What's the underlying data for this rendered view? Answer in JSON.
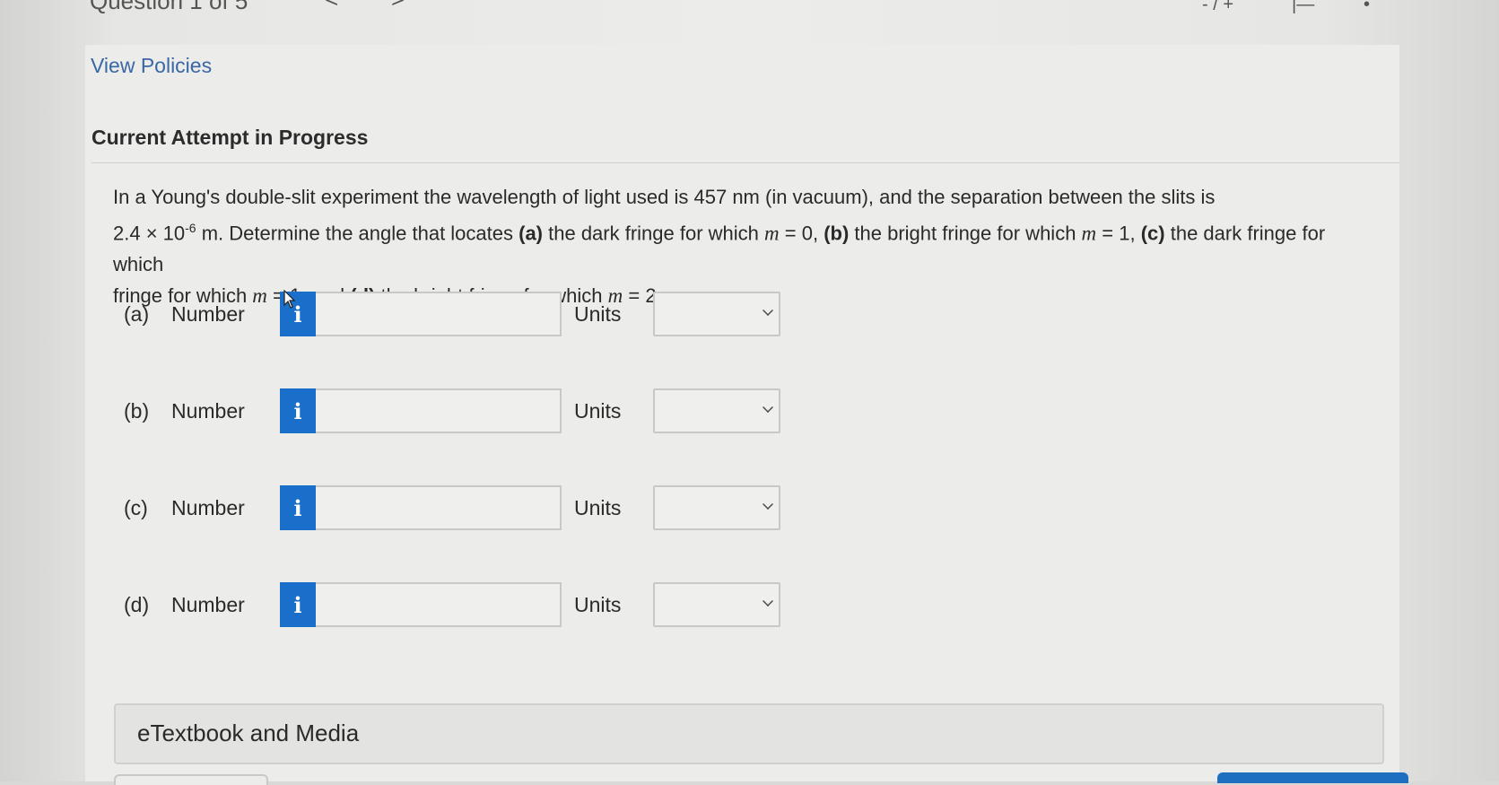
{
  "header": {
    "question_counter": "Question 1 of 5",
    "prev_arrow": "<",
    "next_arrow": ">",
    "view_policies": "View Policies",
    "attempt_status": "Current Attempt in Progress"
  },
  "question": {
    "intro": "In a Young's double-slit experiment the wavelength of light used is 457 nm (in vacuum), and the separation between the slits is",
    "value_mantissa": "2.4 × 10",
    "value_exponent": "-6",
    "value_unit": " m. Determine the angle that locates ",
    "a_label": "(a)",
    "a_text": " the dark fringe for which ",
    "a_m": "m",
    "a_eq": " = 0, ",
    "b_label": "(b)",
    "b_text": " the bright fringe for which ",
    "b_m": "m",
    "b_eq": " = 1, ",
    "c_label": "(c)",
    "c_text": " the dark fringe for which ",
    "c_m": "m",
    "c_eq": " = 1, and ",
    "d_label": "(d)",
    "d_text": " the bright fringe for which ",
    "d_m": "m",
    "d_eq": " = 2."
  },
  "answers": [
    {
      "letter": "(a)",
      "number_label": "Number",
      "info_icon": "i",
      "value": "",
      "units_label": "Units",
      "units_value": ""
    },
    {
      "letter": "(b)",
      "number_label": "Number",
      "info_icon": "i",
      "value": "",
      "units_label": "Units",
      "units_value": ""
    },
    {
      "letter": "(c)",
      "number_label": "Number",
      "info_icon": "i",
      "value": "",
      "units_label": "Units",
      "units_value": ""
    },
    {
      "letter": "(d)",
      "number_label": "Number",
      "info_icon": "i",
      "value": "",
      "units_label": "Units",
      "units_value": ""
    }
  ],
  "etextbook": {
    "label": "eTextbook and Media"
  },
  "colors": {
    "info_blue": "#1a6fcb",
    "link_blue": "#3a67a6",
    "button_blue": "#1f6fc0"
  }
}
